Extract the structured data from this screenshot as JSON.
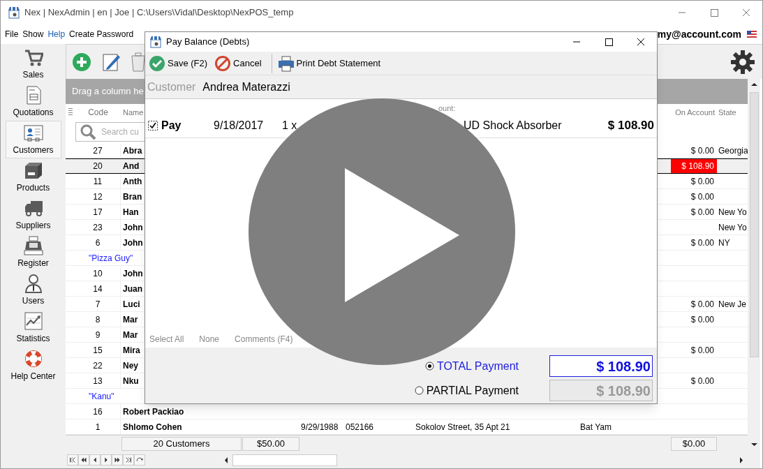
{
  "window": {
    "title": "Nex | NexAdmin | en | Joe | C:\\Users\\Vidal\\Desktop\\NexPOS_temp"
  },
  "menu": [
    {
      "label": "File",
      "kind": "item"
    },
    {
      "label": "Show",
      "kind": "item"
    },
    {
      "label": "Help",
      "kind": "link"
    },
    {
      "label": "Create Password",
      "kind": "item"
    }
  ],
  "account": "my@account.com",
  "sidebar": {
    "items": [
      {
        "label": "Sales",
        "selected": false
      },
      {
        "label": "Quotations",
        "selected": false
      },
      {
        "label": "Customers",
        "selected": true
      },
      {
        "label": "Products",
        "selected": false
      },
      {
        "label": "Suppliers",
        "selected": false
      },
      {
        "label": "Register",
        "selected": false
      },
      {
        "label": "Users",
        "selected": false
      },
      {
        "label": "Statistics",
        "selected": false
      },
      {
        "label": "Help Center",
        "selected": false
      }
    ]
  },
  "group_band": "Drag a column he",
  "table": {
    "columns": [
      {
        "label": "Code"
      },
      {
        "label": "Name"
      },
      {
        "label": "On Account"
      },
      {
        "label": "State"
      }
    ],
    "search_placeholder": "Search cu",
    "rows": [
      {
        "kind": "row",
        "code": "27",
        "name": "Abra",
        "on_account": "$ 0.00",
        "state": "Georgia",
        "selected": false,
        "balance_due": false
      },
      {
        "kind": "row",
        "code": "20",
        "name": "And",
        "on_account": "$ 108.90",
        "selected": true,
        "balance_due": true
      },
      {
        "kind": "row",
        "code": "11",
        "name": "Anth",
        "on_account": "$ 0.00",
        "selected": false,
        "balance_due": false
      },
      {
        "kind": "row",
        "code": "12",
        "name": "Bran",
        "on_account": "$ 0.00",
        "selected": false,
        "balance_due": false
      },
      {
        "kind": "row",
        "code": "17",
        "name": "Han",
        "on_account": "$ 0.00",
        "state": "New Yo",
        "selected": false,
        "balance_due": false
      },
      {
        "kind": "row",
        "code": "23",
        "name": "John",
        "state": "New Yo",
        "selected": false,
        "balance_due": false
      },
      {
        "kind": "row",
        "code": "6",
        "name": "John",
        "on_account": "$ 0.00",
        "state": "NY",
        "selected": false,
        "balance_due": false
      },
      {
        "kind": "group",
        "label": "\"Pizza Guy\""
      },
      {
        "kind": "row",
        "code": "10",
        "name": "John",
        "selected": false,
        "balance_due": false
      },
      {
        "kind": "row",
        "code": "14",
        "name": "Juan",
        "selected": false,
        "balance_due": false
      },
      {
        "kind": "row",
        "code": "7",
        "name": "Luci",
        "on_account": "$ 0.00",
        "state": "New Je",
        "selected": false,
        "balance_due": false
      },
      {
        "kind": "row",
        "code": "8",
        "name": "Mar",
        "on_account": "$ 0.00",
        "selected": false,
        "balance_due": false
      },
      {
        "kind": "row",
        "code": "9",
        "name": "Mar",
        "selected": false,
        "balance_due": false
      },
      {
        "kind": "row",
        "code": "15",
        "name": "Mira",
        "on_account": "$ 0.00",
        "selected": false,
        "balance_due": false
      },
      {
        "kind": "row",
        "code": "22",
        "name": "Ney",
        "selected": false,
        "balance_due": false
      },
      {
        "kind": "row",
        "code": "13",
        "name": "Nku",
        "on_account": "$ 0.00",
        "selected": false,
        "balance_due": false
      },
      {
        "kind": "group",
        "label": "\"Kanu\""
      },
      {
        "kind": "row",
        "code": "16",
        "name": "Robert Packiao",
        "selected": false,
        "balance_due": false
      },
      {
        "kind": "row",
        "code": "1",
        "name": "Shlomo Cohen",
        "column_5": "9/29/1988",
        "column_6": "052166",
        "column_7": "Sokolov Street, 35 Apt 21",
        "column_9": "Bat Yam",
        "selected": false,
        "balance_due": false
      }
    ],
    "footer": {
      "count": "20 Customers",
      "total": "$50.00",
      "on_account_total": "$0.00"
    }
  },
  "dialog": {
    "title": "Pay Balance (Debts)",
    "toolbar": [
      {
        "label": "Save (F2)",
        "kind": "save"
      },
      {
        "label": "Cancel",
        "kind": "cancel"
      },
      {
        "label": "Print Debt Statement",
        "kind": "print"
      }
    ],
    "customer_label": "Customer",
    "customer": "Andrea Materazzi",
    "column_fragment": "ount:",
    "debts": [
      {
        "checked": true,
        "label": "Pay",
        "date": "9/18/2017",
        "quantity_fragment": "1 x",
        "item_fragment": "UD Shock Absorber",
        "amount": "$ 108.90"
      }
    ],
    "links": [
      "Select All",
      "None",
      "Comments (F4)"
    ],
    "payment_options": [
      {
        "label": "TOTAL Payment",
        "selected": true,
        "amount": "$ 108.90"
      },
      {
        "label": "PARTIAL Payment",
        "selected": false,
        "amount": "$ 108.90"
      }
    ]
  }
}
